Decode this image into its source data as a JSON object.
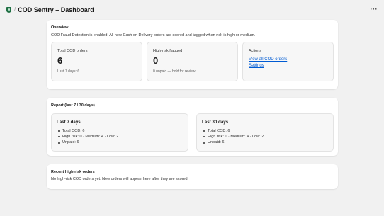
{
  "header": {
    "title": "COD Sentry – Dashboard",
    "separator": "/",
    "more_label": "···"
  },
  "overview": {
    "title": "Overview",
    "description": "COD Fraud Detection is enabled. All new Cash on Delivery orders are scored and tagged when risk is high or medium.",
    "total": {
      "label": "Total COD orders",
      "value": "6",
      "sub": "Last 7 days: 6"
    },
    "high_risk": {
      "label": "High-risk flagged",
      "value": "0",
      "sub": "0 unpaid — hold for review"
    },
    "actions": {
      "label": "Actions",
      "view_all": "View all COD orders",
      "settings": "Settings"
    }
  },
  "report": {
    "title": "Report (last 7 / 30 days)",
    "periods": [
      {
        "title": "Last 7 days",
        "lines": [
          "Total COD: 6",
          "High risk: 0 · Medium: 4 · Low: 2",
          "Unpaid: 6"
        ]
      },
      {
        "title": "Last 30 days",
        "lines": [
          "Total COD: 6",
          "High risk: 0 · Medium: 4 · Low: 2",
          "Unpaid: 6"
        ]
      }
    ]
  },
  "recent": {
    "title": "Recent high-risk orders",
    "empty_text": "No high-risk COD orders yet. New orders will appear here after they are scored."
  },
  "colors": {
    "link": "#005bd3",
    "brand_icon": "#1f6f43",
    "background": "#f1f1f1"
  }
}
